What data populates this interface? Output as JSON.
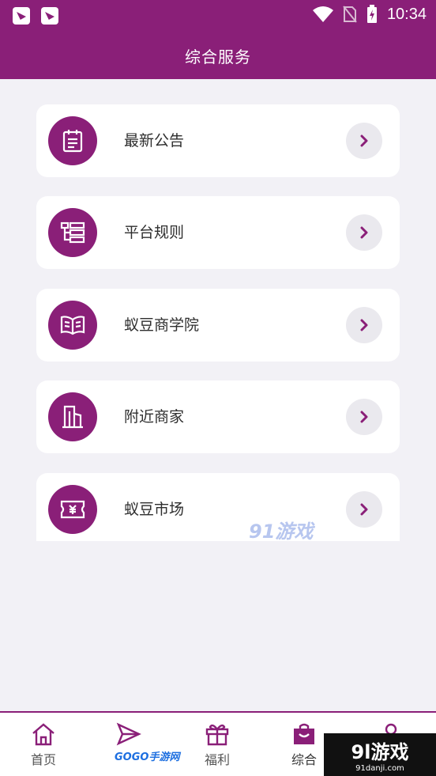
{
  "status_bar": {
    "time": "10:34"
  },
  "header": {
    "title": "综合服务"
  },
  "services": [
    {
      "label": "最新公告",
      "icon": "notice-icon"
    },
    {
      "label": "平台规则",
      "icon": "rules-icon"
    },
    {
      "label": "蚁豆商学院",
      "icon": "book-icon"
    },
    {
      "label": "附近商家",
      "icon": "building-icon"
    },
    {
      "label": "蚁豆市场",
      "icon": "ticket-icon"
    }
  ],
  "tabs": [
    {
      "label": "首页",
      "icon": "home-icon"
    },
    {
      "label": "",
      "icon": "paper-plane-icon"
    },
    {
      "label": "福利",
      "icon": "gift-icon"
    },
    {
      "label": "综合",
      "icon": "bag-icon",
      "active": true
    },
    {
      "label": "",
      "icon": "person-icon"
    }
  ],
  "watermarks": {
    "mid": "91游戏",
    "corner_big": "9l游戏",
    "corner_small": "91danji.com",
    "left": "GOGO手游网"
  },
  "colors": {
    "brand": "#8a1f78",
    "background": "#f2f1f6"
  }
}
